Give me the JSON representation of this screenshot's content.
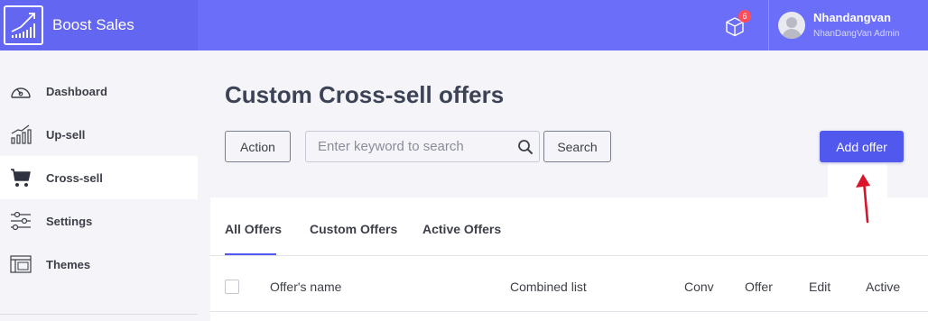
{
  "header": {
    "brand_name": "Boost Sales",
    "notification_count": "6",
    "user_name": "Nhandangvan",
    "user_role": "NhanDangVan Admin"
  },
  "sidebar": {
    "items": [
      {
        "label": "Dashboard",
        "icon": "speedometer-icon"
      },
      {
        "label": "Up-sell",
        "icon": "growth-chart-icon"
      },
      {
        "label": "Cross-sell",
        "icon": "cart-icon",
        "active": true
      },
      {
        "label": "Settings",
        "icon": "sliders-icon"
      },
      {
        "label": "Themes",
        "icon": "layout-icon"
      }
    ]
  },
  "main": {
    "title": "Custom Cross-sell offers",
    "action_label": "Action",
    "search_placeholder": "Enter keyword to search",
    "search_label": "Search",
    "add_offer_label": "Add offer",
    "tabs": [
      "All Offers",
      "Custom Offers",
      "Active Offers"
    ],
    "columns": [
      "Offer's name",
      "Combined list",
      "Conv",
      "Offer",
      "Edit",
      "Active"
    ]
  },
  "colors": {
    "topbar": "#6b6ef8",
    "primary": "#5158ee",
    "annotation_arrow": "#d9142b"
  }
}
